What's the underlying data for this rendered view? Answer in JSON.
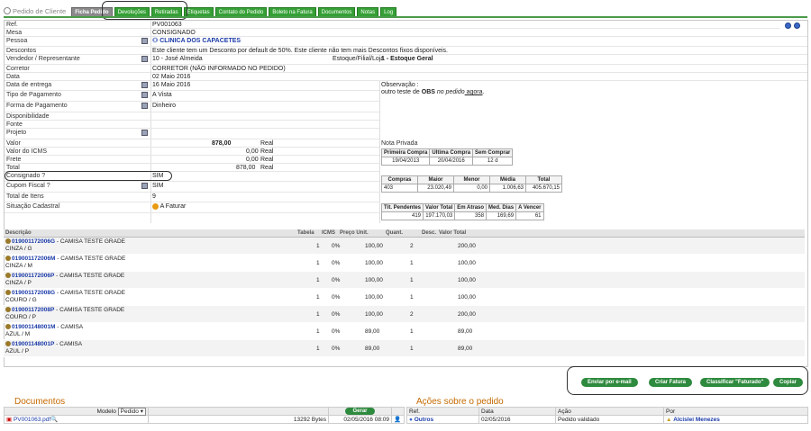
{
  "topbar": {
    "breadcrumb": "Pedido de Cliente",
    "tabs": [
      "Ficha Pedido",
      "Devoluções",
      "Retiradas",
      "Etiquetas",
      "Contato do Pedido",
      "Boleto na Fatura",
      "Documentos",
      "Notas",
      "Log"
    ]
  },
  "fields": {
    "ref": {
      "label": "Ref.",
      "value": "PV001063"
    },
    "mesa": {
      "label": "Mesa",
      "value": "CONSIGNADO"
    },
    "pessoa": {
      "label": "Pessoa",
      "value": "CLINICA DOS CAPACETES"
    },
    "descontos": {
      "label": "Descontos",
      "value": "Este cliente tem um Desconto por default de 50%. Este cliente não tem mais Descontos fixos disponíveis."
    },
    "vendedor": {
      "label": "Vendedor / Representante",
      "value": "10 - José Almeida"
    },
    "estoque": {
      "label": "Estoque/Filial/Loja",
      "value": "1 - Estoque Geral"
    },
    "corretor": {
      "label": "Corretor",
      "value": "CORRETOR (NÃO INFORMADO NO PEDIDO)"
    },
    "data": {
      "label": "Data",
      "value": "02 Maio 2016"
    },
    "entrega": {
      "label": "Data de entrega",
      "value": "16 Maio 2016"
    },
    "tipo_pag": {
      "label": "Tipo de Pagamento",
      "value": "A Vista"
    },
    "forma_pag": {
      "label": "Forma de Pagamento",
      "value": "Dinheiro"
    },
    "disponibilidade": {
      "label": "Disponibilidade",
      "value": ""
    },
    "fonte": {
      "label": "Fonte",
      "value": ""
    },
    "projeto": {
      "label": "Projeto",
      "value": ""
    },
    "valor": {
      "label": "Valor",
      "value": "878,00",
      "unit": "Real"
    },
    "icms": {
      "label": "Valor do ICMS",
      "value": "0,00",
      "unit": "Real"
    },
    "frete": {
      "label": "Frete",
      "value": "0,00",
      "unit": "Real"
    },
    "total": {
      "label": "Total",
      "value": "878,00",
      "unit": "Real"
    },
    "consignado": {
      "label": "Consignado ?",
      "value": "SIM"
    },
    "cupom": {
      "label": "Cupom Fiscal ?",
      "value": "SIM"
    },
    "total_itens": {
      "label": "Total de Itens",
      "value": "9"
    },
    "situacao": {
      "label": "Situação Cadastral",
      "value": "A Faturar"
    }
  },
  "observacao": {
    "label": "Observação :",
    "text_a": "outro teste de ",
    "text_b": "OBS",
    "text_c": " no ",
    "text_d": "pedido",
    "text_e": " agora",
    "text_f": "."
  },
  "nota": {
    "label": "Nota Privada",
    "t1_head": [
      "Primeira Compra",
      "Ultima Compra",
      "Sem Comprar"
    ],
    "t1_row": [
      "19/04/2013",
      "20/04/2016",
      "12 d"
    ],
    "t2_head": [
      "Compras",
      "Maior",
      "Menor",
      "Média",
      "Total"
    ],
    "t2_row": [
      "403",
      "23.020,49",
      "0,00",
      "1.006,63",
      "405.670,15"
    ],
    "t3_head": [
      "Tít. Pendentes",
      "Valor Total",
      "Em Atraso",
      "Med. Dias",
      "A Vencer"
    ],
    "t3_row": [
      "419",
      "197.170,03",
      "358",
      "169,69",
      "61"
    ]
  },
  "items_head": [
    "Descrição",
    "Tabela",
    "ICMS",
    "Preço Unit.",
    "Quant.",
    "Desc.",
    "Valor Total"
  ],
  "items": [
    {
      "code": "019001172006G",
      "name": " - CAMISA TESTE GRADE",
      "variant": "CINZA / G",
      "tabela": "1",
      "icms": "0%",
      "preco": "100,00",
      "qtd": "2",
      "total": "200,00"
    },
    {
      "code": "019001172006M",
      "name": " - CAMISA TESTE GRADE",
      "variant": "CINZA / M",
      "tabela": "1",
      "icms": "0%",
      "preco": "100,00",
      "qtd": "1",
      "total": "100,00"
    },
    {
      "code": "019001172006P",
      "name": " - CAMISA TESTE GRADE",
      "variant": "CINZA / P",
      "tabela": "1",
      "icms": "0%",
      "preco": "100,00",
      "qtd": "1",
      "total": "100,00"
    },
    {
      "code": "019001172008G",
      "name": " - CAMISA TESTE GRADE",
      "variant": "COURO / G",
      "tabela": "1",
      "icms": "0%",
      "preco": "100,00",
      "qtd": "1",
      "total": "100,00"
    },
    {
      "code": "019001172008P",
      "name": " - CAMISA TESTE GRADE",
      "variant": "COURO / P",
      "tabela": "1",
      "icms": "0%",
      "preco": "100,00",
      "qtd": "2",
      "total": "200,00"
    },
    {
      "code": "019001148001M",
      "name": " - CAMISA",
      "variant": "AZUL / M",
      "tabela": "1",
      "icms": "0%",
      "preco": "89,00",
      "qtd": "1",
      "total": "89,00"
    },
    {
      "code": "019001148001P",
      "name": " - CAMISA",
      "variant": "AZUL / P",
      "tabela": "1",
      "icms": "0%",
      "preco": "89,00",
      "qtd": "1",
      "total": "89,00"
    }
  ],
  "actions": [
    "Enviar por e-mail",
    "Criar Fatura",
    "Classificar \"Faturado\"",
    "Copiar"
  ],
  "docs": {
    "title": "Documentos",
    "modelo_label": "Modelo",
    "modelo_value": "Pedido",
    "gerar": "Gerar",
    "file": "PV001063.pdf",
    "size": "13292 Bytes",
    "date": "02/05/2016 08:09"
  },
  "acoes": {
    "title": "Ações sobre o pedido",
    "head": [
      "Ref.",
      "Data",
      "Ação",
      "Por"
    ],
    "row": [
      "Outros",
      "02/05/2016",
      "Pedido validado",
      "Alcislei Menezes"
    ]
  },
  "colors": {
    "tab_green": "#35a035",
    "link_blue": "#1a3aa8",
    "section_orange": "#c56a00"
  }
}
